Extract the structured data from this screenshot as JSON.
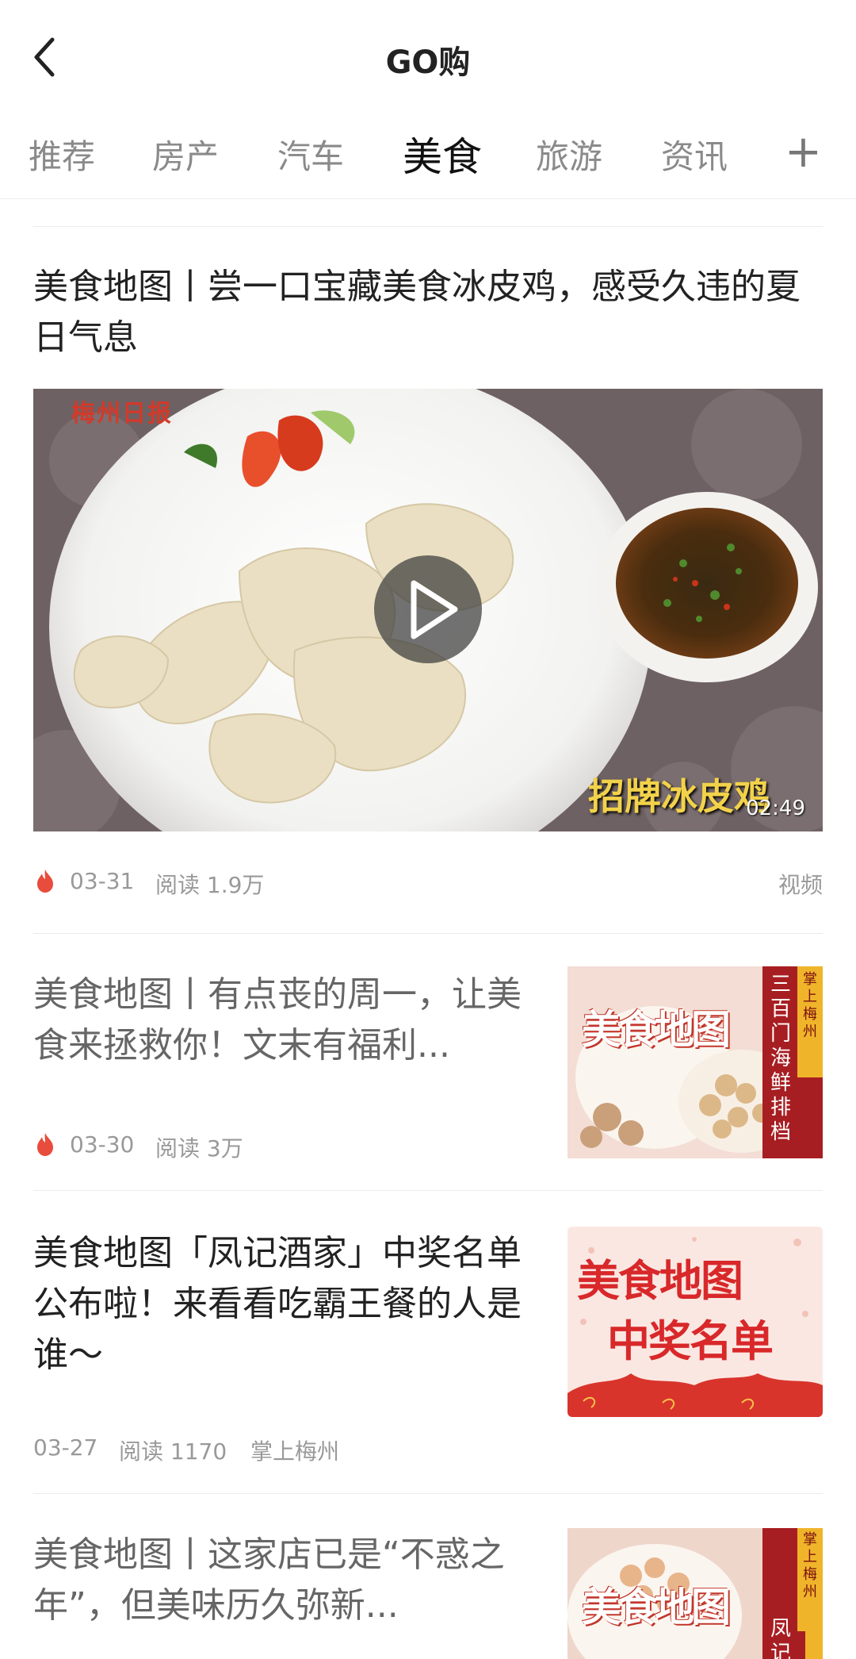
{
  "header": {
    "title": "GO购"
  },
  "tabs": [
    {
      "label": "推荐"
    },
    {
      "label": "房产"
    },
    {
      "label": "汽车"
    },
    {
      "label": "美食"
    },
    {
      "label": "旅游"
    },
    {
      "label": "资讯"
    }
  ],
  "tabs_add_label": "+",
  "featured": {
    "title": "美食地图丨尝一口宝藏美食冰皮鸡，感受久违的夏日气息",
    "video_watermark": "梅州日报",
    "video_caption": "招牌冰皮鸡",
    "duration": "02:49",
    "date": "03-31",
    "reads": "阅读 1.9万",
    "type_label": "视频"
  },
  "articles": [
    {
      "title": "美食地图丨有点丧的周一，让美食来拯救你！文末有福利...",
      "date": "03-30",
      "reads": "阅读 3万",
      "thumb_side": "掌上梅州",
      "thumb_right": "三百门海鲜排档",
      "thumb_big": "美食地图"
    },
    {
      "title": "美食地图「凤记酒家」中奖名单公布啦！来看看吃霸王餐的人是谁～",
      "date": "03-27",
      "reads": "阅读 1170",
      "source": "掌上梅州",
      "thumb_line1": "美食地图",
      "thumb_line2": "中奖名单"
    },
    {
      "title": "美食地图丨这家店已是“不惑之年”，但美味历久弥新...",
      "thumb_side": "掌上梅州",
      "thumb_right": "凤记",
      "thumb_big": "美食地图"
    }
  ],
  "colors": {
    "accent_red": "#e84c3d",
    "active_tab": "#111111",
    "inactive_tab": "#8a8a8a",
    "meta_gray": "#999999"
  }
}
